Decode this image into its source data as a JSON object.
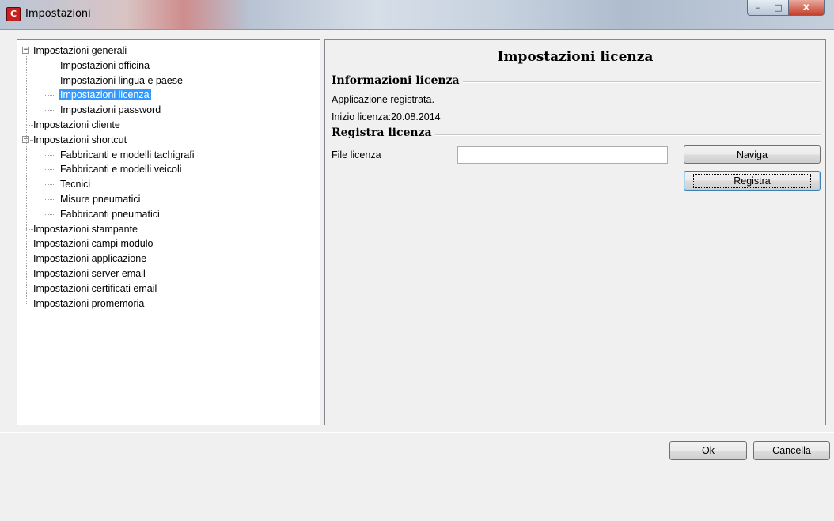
{
  "window": {
    "title": "Impostazioni",
    "app_icon_glyph": "C",
    "controls": {
      "minimize": "–",
      "maximize": "□",
      "close": "x"
    }
  },
  "tree": {
    "items": [
      {
        "label": "Impostazioni generali",
        "level": 0,
        "expanded": true
      },
      {
        "label": "Impostazioni officina",
        "level": 1
      },
      {
        "label": "Impostazioni lingua e paese",
        "level": 1
      },
      {
        "label": "Impostazioni licenza",
        "level": 1,
        "selected": true
      },
      {
        "label": "Impostazioni password",
        "level": 1
      },
      {
        "label": "Impostazioni cliente",
        "level": 0
      },
      {
        "label": "Impostazioni shortcut",
        "level": 0,
        "expanded": true
      },
      {
        "label": "Fabbricanti e modelli tachigrafi",
        "level": 1
      },
      {
        "label": "Fabbricanti e modelli veicoli",
        "level": 1
      },
      {
        "label": "Tecnici",
        "level": 1
      },
      {
        "label": "Misure pneumatici",
        "level": 1
      },
      {
        "label": "Fabbricanti pneumatici",
        "level": 1
      },
      {
        "label": "Impostazioni stampante",
        "level": 0
      },
      {
        "label": "Impostazioni campi modulo",
        "level": 0
      },
      {
        "label": "Impostazioni applicazione",
        "level": 0
      },
      {
        "label": "Impostazioni server email",
        "level": 0
      },
      {
        "label": "Impostazioni certificati email",
        "level": 0
      },
      {
        "label": "Impostazioni promemoria",
        "level": 0
      }
    ],
    "expander_minus": "−"
  },
  "license_panel": {
    "title": "Impostazioni licenza",
    "info_section": {
      "title": "Informazioni licenza",
      "status": "Applicazione registrata.",
      "start_label": "Inizio licenza:",
      "start_date": "20.08.2014"
    },
    "register_section": {
      "title": "Registra licenza",
      "file_label": "File licenza",
      "file_value": "",
      "browse_label": "Naviga",
      "register_label": "Registra"
    }
  },
  "footer": {
    "ok_label": "Ok",
    "cancel_label": "Cancella"
  },
  "colors": {
    "selection": "#3399ff",
    "background": "#f0f0f0"
  }
}
